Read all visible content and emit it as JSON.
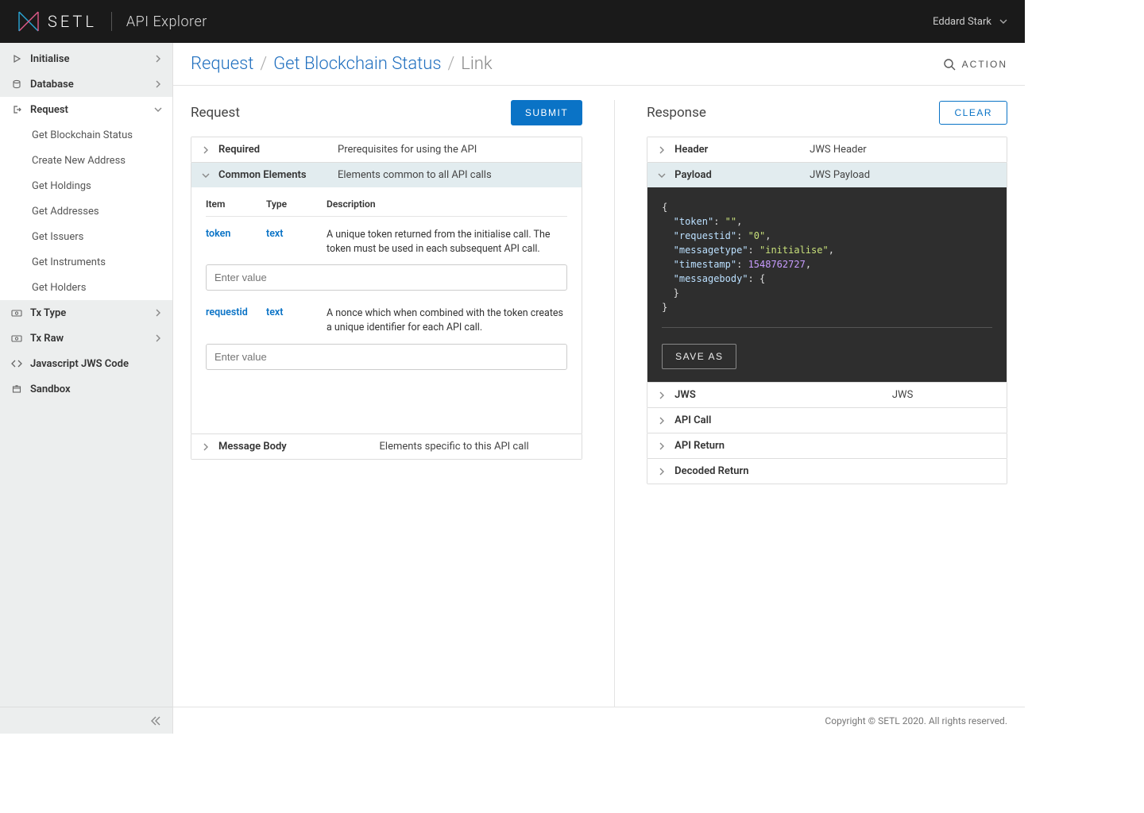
{
  "header": {
    "brand": "SETL",
    "app_title": "API Explorer",
    "user_name": "Eddard Stark"
  },
  "breadcrumb": {
    "items": [
      "Request",
      "Get Blockchain Status",
      "Link"
    ],
    "action_label": "ACTION"
  },
  "sidebar": {
    "items": [
      {
        "icon": "play-icon",
        "label": "Initialise",
        "expandable": true
      },
      {
        "icon": "database-icon",
        "label": "Database",
        "expandable": true
      },
      {
        "icon": "enter-icon",
        "label": "Request",
        "expandable": true,
        "active": true,
        "children": [
          "Get Blockchain Status",
          "Create New Address",
          "Get Holdings",
          "Get Addresses",
          "Get Issuers",
          "Get Instruments",
          "Get Holders"
        ]
      },
      {
        "icon": "tx-icon",
        "label": "Tx Type",
        "expandable": true
      },
      {
        "icon": "tx-icon",
        "label": "Tx Raw",
        "expandable": true
      },
      {
        "icon": "code-icon",
        "label": "Javascript JWS Code",
        "expandable": false
      },
      {
        "icon": "box-icon",
        "label": "Sandbox",
        "expandable": false
      }
    ]
  },
  "request": {
    "title": "Request",
    "submit_label": "SUBMIT",
    "sections": {
      "required": {
        "label": "Required",
        "desc": "Prerequisites for using the API"
      },
      "common": {
        "label": "Common Elements",
        "desc": "Elements common to all API calls"
      },
      "message_body": {
        "label": "Message Body",
        "desc": "Elements specific to this API call"
      }
    },
    "param_columns": {
      "item": "Item",
      "type": "Type",
      "description": "Description"
    },
    "params": [
      {
        "name": "token",
        "type": "text",
        "desc": "A unique token returned from the initialise call. The token must be used in each subsequent API call.",
        "placeholder": "Enter value"
      },
      {
        "name": "requestid",
        "type": "text",
        "desc": "A nonce which when combined with the token creates a unique identifier for each API call.",
        "placeholder": "Enter value"
      }
    ]
  },
  "response": {
    "title": "Response",
    "clear_label": "CLEAR",
    "save_as_label": "SAVE AS",
    "sections": {
      "header": {
        "label": "Header",
        "desc": "JWS Header"
      },
      "payload": {
        "label": "Payload",
        "desc": "JWS Payload"
      },
      "jws": {
        "label": "JWS",
        "desc": "JWS"
      },
      "api_call": {
        "label": "API Call",
        "desc": ""
      },
      "api_return": {
        "label": "API Return",
        "desc": ""
      },
      "decoded_return": {
        "label": "Decoded Return",
        "desc": ""
      }
    },
    "payload_json": {
      "token": "",
      "requestid": "0",
      "messagetype": "initialise",
      "timestamp": 1548762727,
      "messagebody": {}
    }
  },
  "footer": {
    "copyright": "Copyright © SETL 2020. All rights reserved."
  }
}
